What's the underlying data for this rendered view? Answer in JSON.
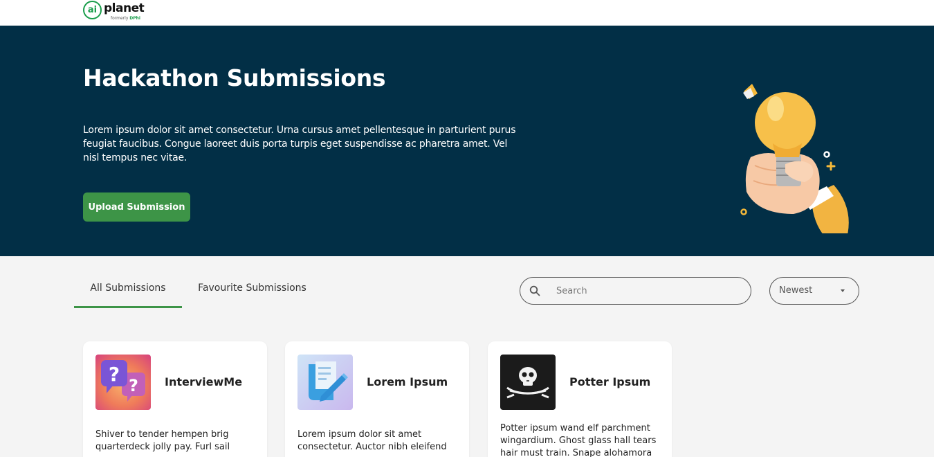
{
  "brand": {
    "logo_mark": "ai",
    "logo_word": "planet",
    "logo_sub_prefix": "formerly ",
    "logo_sub_brand": "DPhi"
  },
  "hero": {
    "title": "Hackathon Submissions",
    "description": "Lorem ipsum dolor sit amet consectetur. Urna cursus amet pellentesque in parturient purus feugiat faucibus. Congue laoreet duis porta turpis eget suspendisse ac pharetra amet. Vel nisl tempus nec vitae.",
    "upload_label": "Upload Submission",
    "background": "#022f46",
    "accent": "#3d9447"
  },
  "tabs": [
    {
      "label": "All Submissions",
      "active": true
    },
    {
      "label": "Favourite Submissions",
      "active": false
    }
  ],
  "search": {
    "placeholder": "Search",
    "value": ""
  },
  "sort": {
    "selected": "Newest"
  },
  "cards": [
    {
      "title": "InterviewMe",
      "icon": "question-bubbles-icon",
      "description": "Shiver to tender hempen brig quarterdeck jolly pay. Furl sail"
    },
    {
      "title": "Lorem Ipsum",
      "icon": "document-edit-icon",
      "description": "Lorem ipsum dolor sit amet consectetur. Auctor nibh eleifend"
    },
    {
      "title": "Potter Ipsum",
      "icon": "pirate-flag-icon",
      "description": "Potter ipsum wand elf parchment wingardium. Ghost glass hall tears hair must train. Snape alohamora"
    }
  ]
}
